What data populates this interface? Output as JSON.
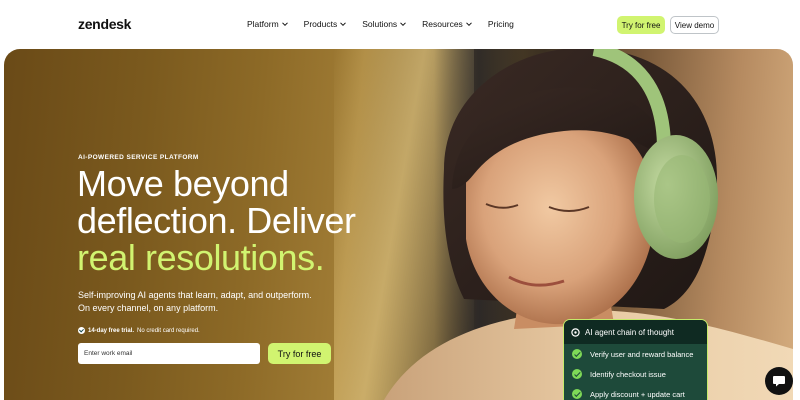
{
  "brand": {
    "logo_text": "zendesk",
    "accent": "#d1f470"
  },
  "nav": {
    "items": [
      {
        "label": "Platform",
        "dropdown": true
      },
      {
        "label": "Products",
        "dropdown": true
      },
      {
        "label": "Solutions",
        "dropdown": true
      },
      {
        "label": "Resources",
        "dropdown": true
      },
      {
        "label": "Pricing",
        "dropdown": false
      }
    ],
    "try_label": "Try for free",
    "demo_label": "View demo"
  },
  "hero": {
    "eyebrow": "AI-POWERED SERVICE PLATFORM",
    "headline_line1": "Move beyond",
    "headline_line2": "deflection. Deliver",
    "headline_highlight": "real resolutions.",
    "sub_line1": "Self-improving AI agents that learn, adapt, and outperform.",
    "sub_line2": "On every channel, on any platform.",
    "trial_bold": "14-day free trial.",
    "trial_rest": "No credit card required.",
    "email_placeholder": "Enter work email",
    "cta_label": "Try for free"
  },
  "ai_card": {
    "title": "AI agent chain of thought",
    "steps": [
      "Verify user and reward balance",
      "Identify checkout issue",
      "Apply discount + update cart"
    ]
  },
  "chat": {
    "icon": "chat-bubble-icon"
  }
}
